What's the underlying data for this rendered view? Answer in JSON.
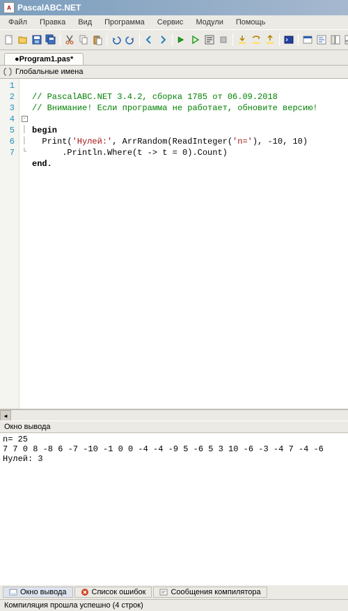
{
  "title": "PascalABC.NET",
  "menu": {
    "file": "Файл",
    "edit": "Правка",
    "view": "Вид",
    "program": "Программа",
    "service": "Сервис",
    "modules": "Модули",
    "help": "Помощь"
  },
  "file_tab": "●Program1.pas*",
  "names_bar": "Глобальные имена",
  "code": {
    "lines": [
      "1",
      "2",
      "3",
      "4",
      "5",
      "6",
      "7"
    ],
    "l1": "// PascalABC.NET 3.4.2, сборка 1785 от 06.09.2018",
    "l2": "// Внимание! Если программа не работает, обновите версию!",
    "l4_kw": "begin",
    "l5_a": "  Print(",
    "l5_str": "'Нулей:'",
    "l5_b": ", ArrRandom(ReadInteger(",
    "l5_str2": "'n='",
    "l5_c": "), -10, 10)",
    "l6": "      .Println.Where(t -> t = 0).Count)",
    "l7_kw": "end."
  },
  "output": {
    "header": "Окно вывода",
    "text": "n= 25\n7 7 0 8 -8 6 -7 -10 -1 0 0 -4 -4 -9 5 -6 5 3 10 -6 -3 -4 7 -4 -6\nНулей: 3"
  },
  "out_tabs": {
    "output": "Окно вывода",
    "errors": "Список ошибок",
    "compiler": "Сообщения компилятора"
  },
  "status": "Компиляция прошла успешно (4 строк)"
}
